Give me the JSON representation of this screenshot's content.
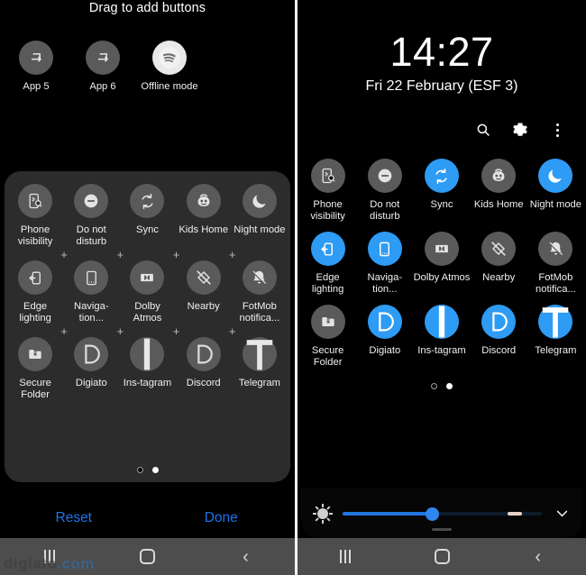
{
  "left_panel": {
    "header_title": "Drag to add buttons",
    "tray_tiles": [
      {
        "label": "App 5",
        "icon": "app-shortcut-icon",
        "state": "off"
      },
      {
        "label": "App 6",
        "icon": "app-shortcut-icon",
        "state": "off"
      },
      {
        "label": "Offline mode",
        "icon": "spotify-icon",
        "state": "white"
      }
    ],
    "grid_rows": [
      [
        {
          "label": "Phone visibility",
          "icon": "phone-visibility-icon",
          "state": "off"
        },
        {
          "label": "Do not disturb",
          "icon": "do-not-disturb-icon",
          "state": "off"
        },
        {
          "label": "Sync",
          "icon": "sync-icon",
          "state": "off"
        },
        {
          "label": "Kids Home",
          "icon": "kids-home-icon",
          "state": "off"
        },
        {
          "label": "Night mode",
          "icon": "night-mode-icon",
          "state": "off"
        }
      ],
      [
        {
          "label": "Edge lighting",
          "icon": "edge-lighting-icon",
          "state": "off"
        },
        {
          "label": "Naviga-tion...",
          "icon": "navigation-bar-icon",
          "state": "off"
        },
        {
          "label": "Dolby Atmos",
          "icon": "dolby-atmos-icon",
          "state": "off"
        },
        {
          "label": "Nearby",
          "icon": "nearby-share-off-icon",
          "state": "off"
        },
        {
          "label": "FotMob notifica...",
          "icon": "bell-off-icon",
          "state": "off"
        }
      ],
      [
        {
          "label": "Secure Folder",
          "icon": "secure-folder-icon",
          "state": "off"
        },
        {
          "label": "Digiato",
          "icon": "digiato-icon",
          "state": "off"
        },
        {
          "label": "Ins-tagram",
          "icon": "instagram-icon",
          "state": "off"
        },
        {
          "label": "Discord",
          "icon": "discord-icon",
          "state": "off"
        },
        {
          "label": "Telegram",
          "icon": "telegram-icon",
          "state": "off"
        }
      ]
    ],
    "add_marker": "+",
    "pagination": {
      "total": 2,
      "active_index": 1
    },
    "reset_label": "Reset",
    "done_label": "Done"
  },
  "right_panel": {
    "clock": "14:27",
    "date": "Fri 22 February (ESF 3)",
    "header_icons": [
      {
        "name": "search-icon"
      },
      {
        "name": "gear-icon"
      },
      {
        "name": "overflow-menu-icon"
      }
    ],
    "grid_rows": [
      [
        {
          "label": "Phone visibility",
          "icon": "phone-visibility-icon",
          "state": "off"
        },
        {
          "label": "Do not disturb",
          "icon": "do-not-disturb-icon",
          "state": "off"
        },
        {
          "label": "Sync",
          "icon": "sync-icon",
          "state": "on"
        },
        {
          "label": "Kids Home",
          "icon": "kids-home-icon",
          "state": "off"
        },
        {
          "label": "Night mode",
          "icon": "night-mode-icon",
          "state": "on"
        }
      ],
      [
        {
          "label": "Edge lighting",
          "icon": "edge-lighting-icon",
          "state": "on"
        },
        {
          "label": "Naviga-tion...",
          "icon": "navigation-bar-icon",
          "state": "on"
        },
        {
          "label": "Dolby Atmos",
          "icon": "dolby-atmos-icon",
          "state": "off"
        },
        {
          "label": "Nearby",
          "icon": "nearby-share-off-icon",
          "state": "off"
        },
        {
          "label": "FotMob notifica...",
          "icon": "bell-off-icon",
          "state": "off"
        }
      ],
      [
        {
          "label": "Secure Folder",
          "icon": "secure-folder-icon",
          "state": "off"
        },
        {
          "label": "Digiato",
          "icon": "digiato-icon",
          "state": "on"
        },
        {
          "label": "Ins-tagram",
          "icon": "instagram-icon",
          "state": "on"
        },
        {
          "label": "Discord",
          "icon": "discord-icon",
          "state": "on"
        },
        {
          "label": "Telegram",
          "icon": "telegram-icon",
          "state": "on"
        }
      ]
    ],
    "pagination": {
      "total": 2,
      "active_index": 1
    },
    "brightness": {
      "icon": "brightness-icon",
      "value_percent": 45,
      "expand_icon": "chevron-down-icon"
    }
  },
  "nav_bar": {
    "recents": "recents-icon",
    "home": "home-icon",
    "back": "back-icon",
    "back_glyph": "‹"
  },
  "watermark": {
    "text": "digiato",
    "suffix": ".com"
  },
  "colors": {
    "accent_blue": "#2e9bf5",
    "link_blue": "#1e73ea",
    "tile_off": "#5a5a5a",
    "card_bg": "#2c2c2c",
    "nav_bg": "#4d4d4d"
  }
}
